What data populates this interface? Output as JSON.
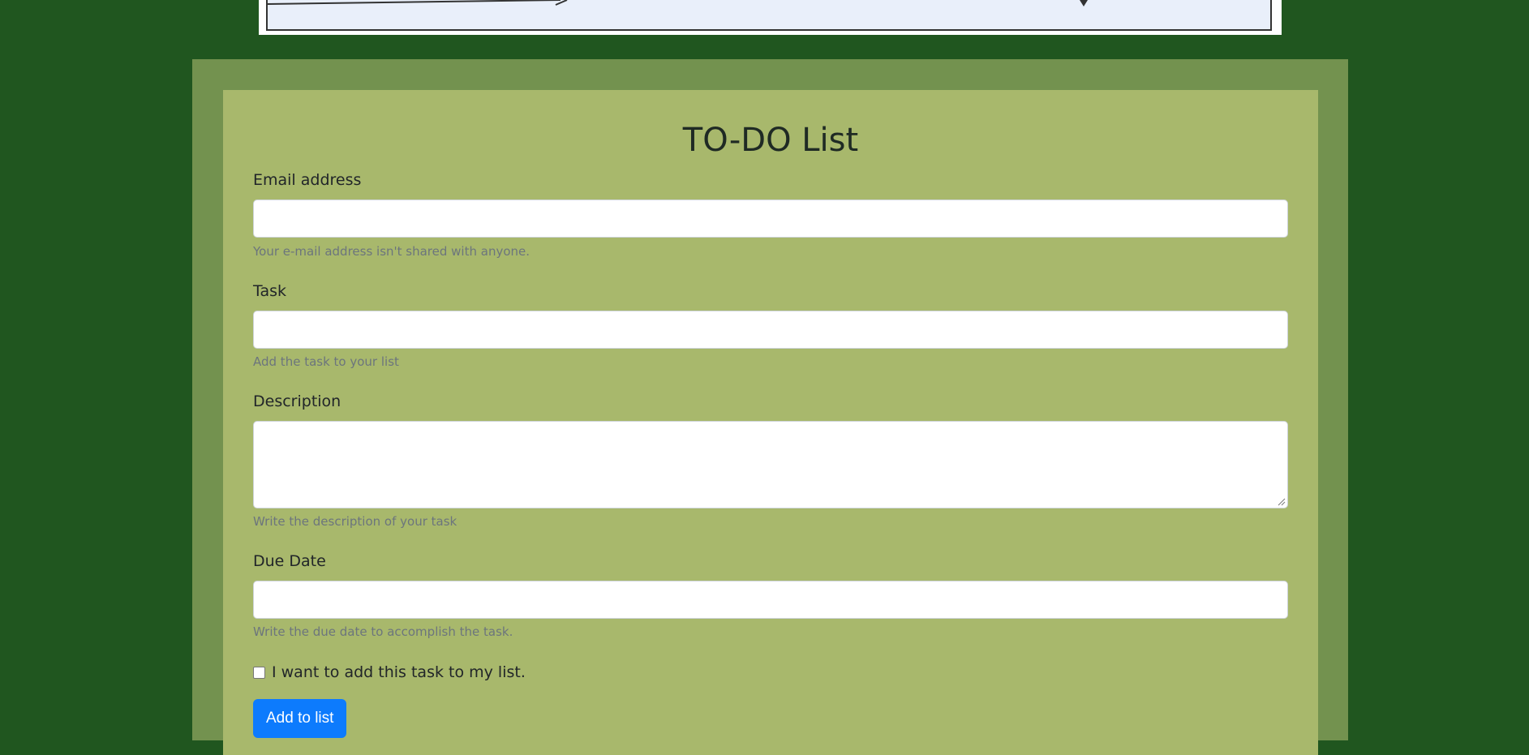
{
  "form": {
    "title": "TO-DO List",
    "email": {
      "label": "Email address",
      "value": "",
      "help": "Your e-mail address isn't shared with anyone."
    },
    "task": {
      "label": "Task",
      "value": "",
      "help": "Add the task to your list"
    },
    "description": {
      "label": "Description",
      "value": "",
      "help": "Write the description of your task"
    },
    "due_date": {
      "label": "Due Date",
      "value": "",
      "help": "Write the due date to accomplish the task."
    },
    "checkbox": {
      "label": "I want to add this task to my list.",
      "checked": false
    },
    "submit_label": "Add to list"
  },
  "colors": {
    "page_background": "#20561f",
    "outer_card": "#73924f",
    "inner_card": "#a8b86c",
    "button": "#0d7bfd"
  }
}
